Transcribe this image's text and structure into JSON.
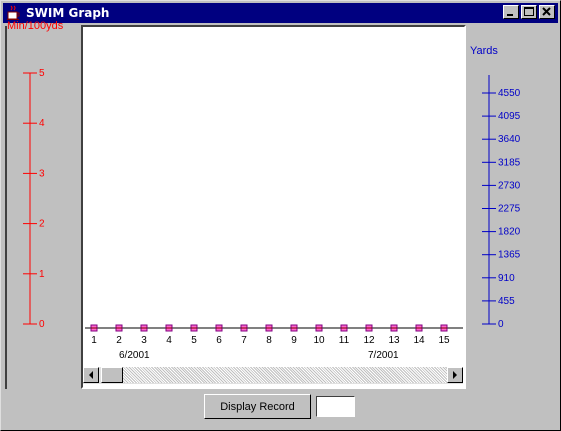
{
  "window": {
    "title": "SWIM Graph",
    "icon": "java-cup-icon",
    "controls": [
      "minimize",
      "maximize",
      "close"
    ]
  },
  "left_axis": {
    "title": "Min/100yds",
    "color": "#ff0000",
    "ticks": [
      "5",
      "4",
      "3",
      "2",
      "1",
      "0"
    ]
  },
  "right_axis": {
    "title": "Yards",
    "color": "#0000c8",
    "ticks": [
      "4550",
      "4095",
      "3640",
      "3185",
      "2730",
      "2275",
      "1820",
      "1365",
      "910",
      "455",
      "0"
    ]
  },
  "x_axis": {
    "days": [
      "1",
      "2",
      "3",
      "4",
      "5",
      "6",
      "7",
      "8",
      "9",
      "10",
      "11",
      "12",
      "13",
      "14",
      "15"
    ],
    "months": [
      "6/2001",
      "7/2001"
    ]
  },
  "footer": {
    "display_button": "Display Record",
    "record_value": ""
  }
}
